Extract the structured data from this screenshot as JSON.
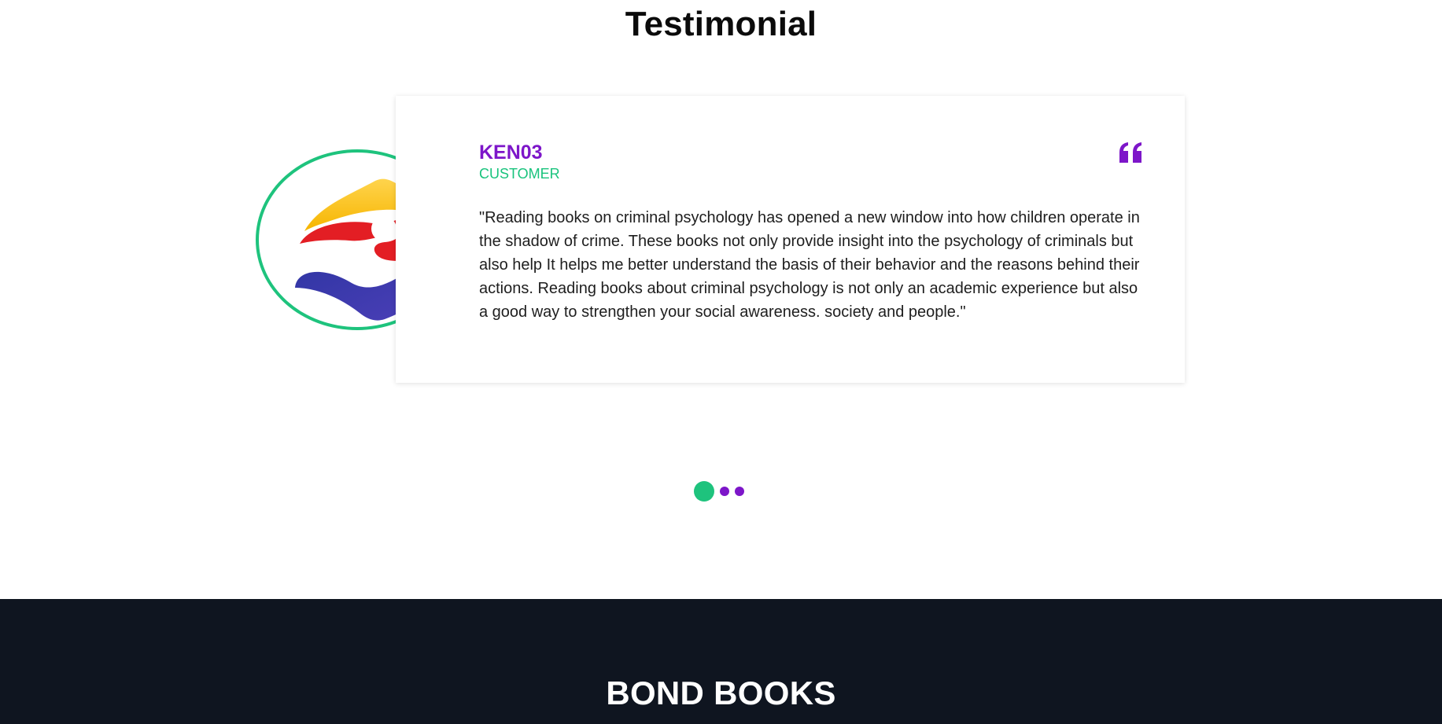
{
  "section": {
    "title": "Testimonial"
  },
  "testimonial": {
    "author": "KEN03",
    "role": "CUSTOMER",
    "quote": "\"Reading books on criminal psychology has opened a new window into how children operate in the shadow of crime. These books not only provide insight into the psychology of criminals but also help It helps me better understand the basis of their behavior and the reasons behind their actions. Reading books about criminal psychology is not only an academic experience but also a good way to strengthen your social awareness. society and people.\"",
    "avatar_icon": "brand-logo-icon",
    "quote_icon": "quote-icon"
  },
  "carousel": {
    "slide_count": 3,
    "active_index": 0
  },
  "footer": {
    "title": "BOND BOOKS"
  },
  "colors": {
    "accent_purple": "#7d16c9",
    "accent_green": "#1ec37d",
    "footer_bg": "#0f1520"
  }
}
